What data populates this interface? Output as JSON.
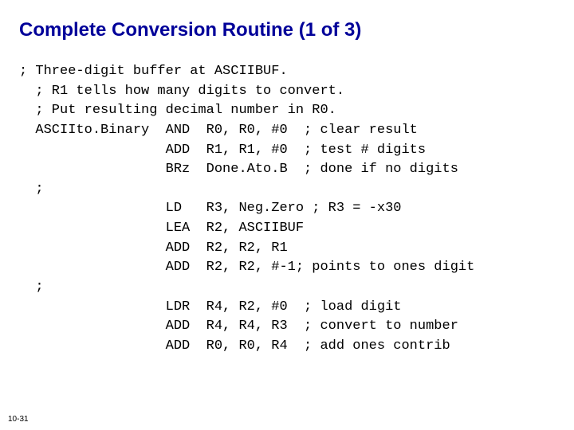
{
  "title": "Complete Conversion Routine (1 of 3)",
  "code": {
    "l01": "; Three-digit buffer at ASCIIBUF.",
    "l02": "  ; R1 tells how many digits to convert.",
    "l03": "  ; Put resulting decimal number in R0.",
    "l04": "  ASCIIto.Binary  AND  R0, R0, #0  ; clear result",
    "l05": "                  ADD  R1, R1, #0  ; test # digits",
    "l06": "                  BRz  Done.Ato.B  ; done if no digits",
    "l07": "  ;",
    "l08": "                  LD   R3, Neg.Zero ; R3 = -x30",
    "l09": "                  LEA  R2, ASCIIBUF",
    "l10": "                  ADD  R2, R2, R1",
    "l11": "                  ADD  R2, R2, #-1; points to ones digit",
    "l12": "  ;",
    "l13": "                  LDR  R4, R2, #0  ; load digit",
    "l14": "                  ADD  R4, R4, R3  ; convert to number",
    "l15": "                  ADD  R0, R0, R4  ; add ones contrib"
  },
  "page_number": "10-31"
}
